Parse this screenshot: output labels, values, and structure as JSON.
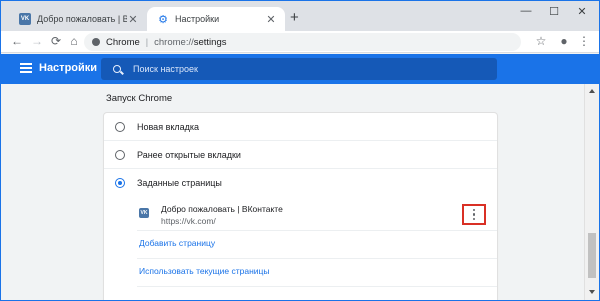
{
  "tabs": [
    {
      "title": "Добро пожаловать | ВКонтакте",
      "favicon": "vk-logo-icon",
      "favicon_text": "VK",
      "active": false
    },
    {
      "title": "Настройки",
      "favicon": "gear-icon",
      "active": true
    }
  ],
  "window_controls": {
    "minimize": "—",
    "maximize": "☐",
    "close": "✕"
  },
  "omnibox": {
    "chrome_label": "Chrome",
    "separator": "|",
    "url_prefix": "chrome://",
    "url_path": "settings"
  },
  "settings_header": {
    "title": "Настройки",
    "search_placeholder": "Поиск настроек"
  },
  "startup": {
    "section_title": "Запуск Chrome",
    "options": [
      {
        "label": "Новая вкладка",
        "selected": false
      },
      {
        "label": "Ранее открытые вкладки",
        "selected": false
      },
      {
        "label": "Заданные страницы",
        "selected": true
      }
    ],
    "pages": [
      {
        "name": "Добро пожаловать | ВКонтакте",
        "url": "https://vk.com/",
        "favicon_text": "VK"
      }
    ],
    "add_page_link": "Добавить страницу",
    "use_current_link": "Использовать текущие страницы"
  },
  "colors": {
    "accent": "#1a73e8",
    "header_bg": "#1a73e8",
    "highlight_border": "#d93025",
    "vk_brand": "#4a76a8"
  }
}
